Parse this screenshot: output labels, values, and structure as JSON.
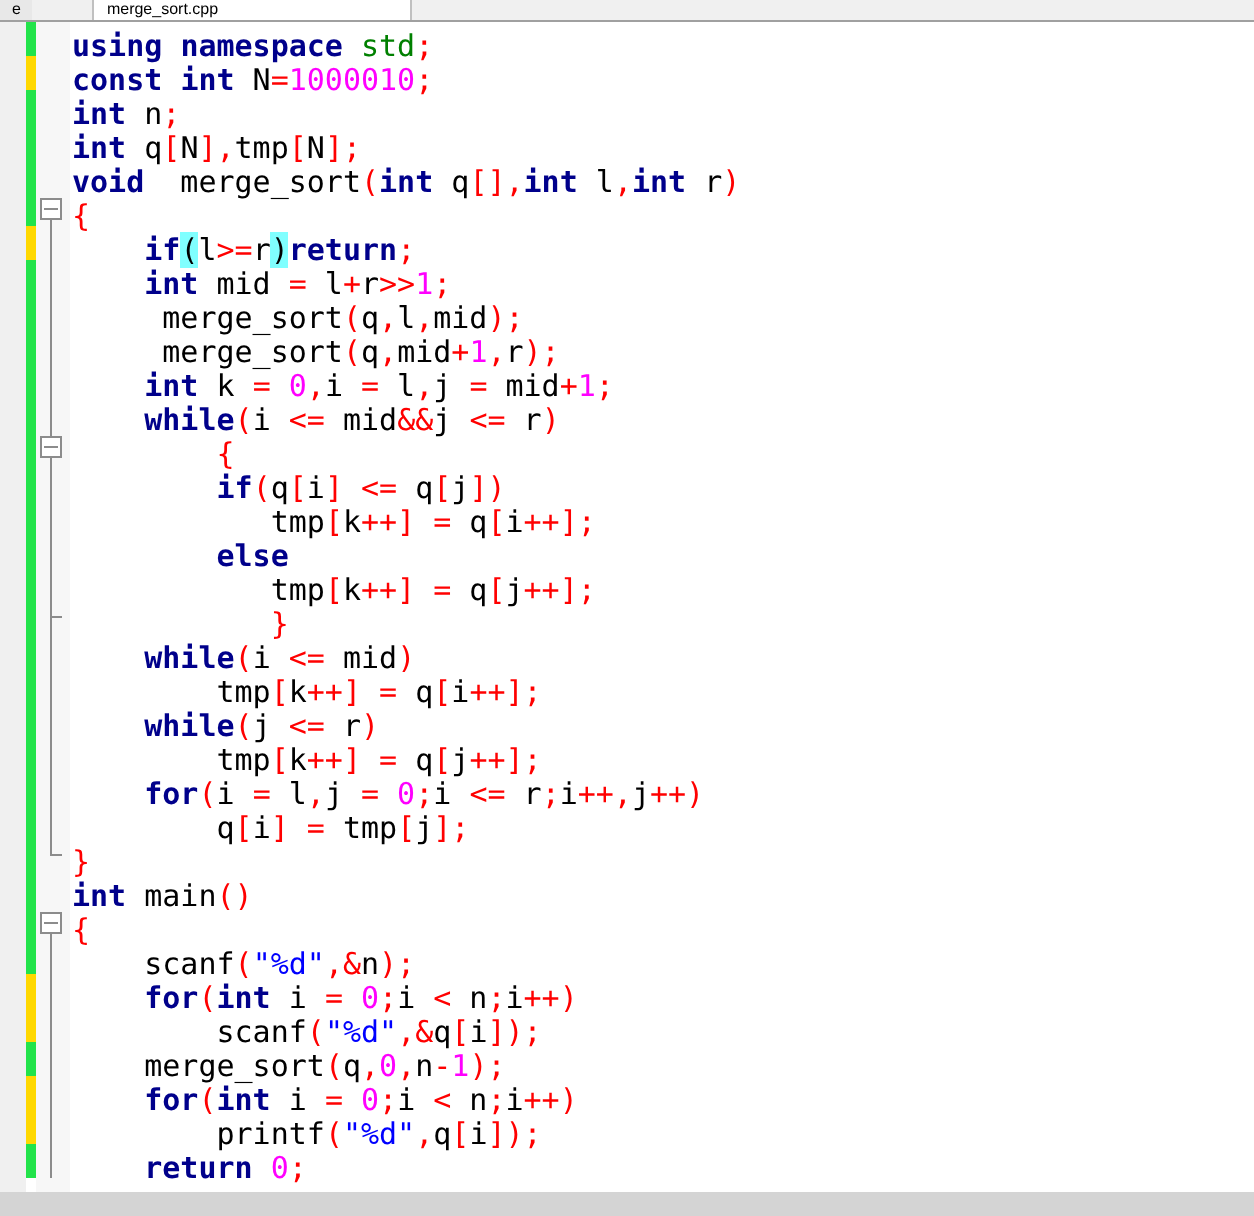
{
  "tabs": [
    {
      "label": "e",
      "selected": false
    },
    {
      "label": "merge_sort.cpp",
      "selected": true
    }
  ],
  "lines": [
    {
      "modified": false,
      "kind": "plain",
      "tokens": [
        {
          "kind": "kw",
          "text": "using "
        },
        {
          "kind": "kw",
          "text": "namespace "
        },
        {
          "kind": "ns",
          "text": "std"
        },
        {
          "kind": "op",
          "text": ";"
        }
      ]
    },
    {
      "modified": true,
      "kind": "plain",
      "tokens": [
        {
          "kind": "kw",
          "text": "const "
        },
        {
          "kind": "kw",
          "text": "int"
        },
        {
          "kind": "id",
          "text": " N"
        },
        {
          "kind": "op",
          "text": "="
        },
        {
          "kind": "num",
          "text": "1000010"
        },
        {
          "kind": "op",
          "text": ";"
        }
      ]
    },
    {
      "modified": false,
      "kind": "plain",
      "tokens": [
        {
          "kind": "kw",
          "text": "int"
        },
        {
          "kind": "id",
          "text": " n"
        },
        {
          "kind": "op",
          "text": ";"
        }
      ]
    },
    {
      "modified": false,
      "kind": "plain",
      "tokens": [
        {
          "kind": "kw",
          "text": "int"
        },
        {
          "kind": "id",
          "text": " q"
        },
        {
          "kind": "op",
          "text": "["
        },
        {
          "kind": "id",
          "text": "N"
        },
        {
          "kind": "op",
          "text": "],"
        },
        {
          "kind": "id",
          "text": "tmp"
        },
        {
          "kind": "op",
          "text": "["
        },
        {
          "kind": "id",
          "text": "N"
        },
        {
          "kind": "op",
          "text": "];"
        }
      ]
    },
    {
      "modified": false,
      "kind": "plain",
      "tokens": [
        {
          "kind": "kw",
          "text": "void"
        },
        {
          "kind": "id",
          "text": "  merge_sort"
        },
        {
          "kind": "op",
          "text": "("
        },
        {
          "kind": "kw",
          "text": "int"
        },
        {
          "kind": "id",
          "text": " q"
        },
        {
          "kind": "op",
          "text": "[],"
        },
        {
          "kind": "kw",
          "text": "int"
        },
        {
          "kind": "id",
          "text": " l"
        },
        {
          "kind": "op",
          "text": ","
        },
        {
          "kind": "kw",
          "text": "int"
        },
        {
          "kind": "id",
          "text": " r"
        },
        {
          "kind": "op",
          "text": ")"
        }
      ]
    },
    {
      "modified": false,
      "kind": "fold_start",
      "tokens": [
        {
          "kind": "op",
          "text": "{"
        }
      ]
    },
    {
      "modified": true,
      "kind": "plain",
      "tokens": [
        {
          "kind": "kw",
          "text": "    if"
        },
        {
          "kind": "match",
          "text": "("
        },
        {
          "kind": "id",
          "text": "l"
        },
        {
          "kind": "op",
          "text": ">="
        },
        {
          "kind": "id",
          "text": "r"
        },
        {
          "kind": "match",
          "text": ")"
        },
        {
          "kind": "kw",
          "text": "return"
        },
        {
          "kind": "op",
          "text": ";"
        }
      ]
    },
    {
      "modified": false,
      "kind": "plain",
      "tokens": [
        {
          "kind": "kw",
          "text": "    int"
        },
        {
          "kind": "id",
          "text": " mid "
        },
        {
          "kind": "op",
          "text": "="
        },
        {
          "kind": "id",
          "text": " l"
        },
        {
          "kind": "op",
          "text": "+"
        },
        {
          "kind": "id",
          "text": "r"
        },
        {
          "kind": "op",
          "text": ">>"
        },
        {
          "kind": "num",
          "text": "1"
        },
        {
          "kind": "op",
          "text": ";"
        }
      ]
    },
    {
      "modified": false,
      "kind": "plain",
      "tokens": [
        {
          "kind": "id",
          "text": "     merge_sort"
        },
        {
          "kind": "op",
          "text": "("
        },
        {
          "kind": "id",
          "text": "q"
        },
        {
          "kind": "op",
          "text": ","
        },
        {
          "kind": "id",
          "text": "l"
        },
        {
          "kind": "op",
          "text": ","
        },
        {
          "kind": "id",
          "text": "mid"
        },
        {
          "kind": "op",
          "text": ");"
        }
      ]
    },
    {
      "modified": false,
      "kind": "plain",
      "tokens": [
        {
          "kind": "id",
          "text": "     merge_sort"
        },
        {
          "kind": "op",
          "text": "("
        },
        {
          "kind": "id",
          "text": "q"
        },
        {
          "kind": "op",
          "text": ","
        },
        {
          "kind": "id",
          "text": "mid"
        },
        {
          "kind": "op",
          "text": "+"
        },
        {
          "kind": "num",
          "text": "1"
        },
        {
          "kind": "op",
          "text": ","
        },
        {
          "kind": "id",
          "text": "r"
        },
        {
          "kind": "op",
          "text": ");"
        }
      ]
    },
    {
      "modified": false,
      "kind": "plain",
      "tokens": [
        {
          "kind": "kw",
          "text": "    int"
        },
        {
          "kind": "id",
          "text": " k "
        },
        {
          "kind": "op",
          "text": "="
        },
        {
          "kind": "num",
          "text": " 0"
        },
        {
          "kind": "op",
          "text": ","
        },
        {
          "kind": "id",
          "text": "i "
        },
        {
          "kind": "op",
          "text": "="
        },
        {
          "kind": "id",
          "text": " l"
        },
        {
          "kind": "op",
          "text": ","
        },
        {
          "kind": "id",
          "text": "j "
        },
        {
          "kind": "op",
          "text": "="
        },
        {
          "kind": "id",
          "text": " mid"
        },
        {
          "kind": "op",
          "text": "+"
        },
        {
          "kind": "num",
          "text": "1"
        },
        {
          "kind": "op",
          "text": ";"
        }
      ]
    },
    {
      "modified": false,
      "kind": "plain",
      "tokens": [
        {
          "kind": "kw",
          "text": "    while"
        },
        {
          "kind": "op",
          "text": "("
        },
        {
          "kind": "id",
          "text": "i "
        },
        {
          "kind": "op",
          "text": "<="
        },
        {
          "kind": "id",
          "text": " mid"
        },
        {
          "kind": "op",
          "text": "&&"
        },
        {
          "kind": "id",
          "text": "j "
        },
        {
          "kind": "op",
          "text": "<="
        },
        {
          "kind": "id",
          "text": " r"
        },
        {
          "kind": "op",
          "text": ")"
        }
      ]
    },
    {
      "modified": false,
      "kind": "fold_start",
      "tokens": [
        {
          "kind": "op",
          "text": "        {"
        }
      ]
    },
    {
      "modified": false,
      "kind": "plain",
      "tokens": [
        {
          "kind": "kw",
          "text": "        if"
        },
        {
          "kind": "op",
          "text": "("
        },
        {
          "kind": "id",
          "text": "q"
        },
        {
          "kind": "op",
          "text": "["
        },
        {
          "kind": "id",
          "text": "i"
        },
        {
          "kind": "op",
          "text": "] <="
        },
        {
          "kind": "id",
          "text": " q"
        },
        {
          "kind": "op",
          "text": "["
        },
        {
          "kind": "id",
          "text": "j"
        },
        {
          "kind": "op",
          "text": "])"
        }
      ]
    },
    {
      "modified": false,
      "kind": "plain",
      "tokens": [
        {
          "kind": "id",
          "text": "           tmp"
        },
        {
          "kind": "op",
          "text": "["
        },
        {
          "kind": "id",
          "text": "k"
        },
        {
          "kind": "op",
          "text": "++] ="
        },
        {
          "kind": "id",
          "text": " q"
        },
        {
          "kind": "op",
          "text": "["
        },
        {
          "kind": "id",
          "text": "i"
        },
        {
          "kind": "op",
          "text": "++];"
        }
      ]
    },
    {
      "modified": false,
      "kind": "plain",
      "tokens": [
        {
          "kind": "kw",
          "text": "        else"
        }
      ]
    },
    {
      "modified": false,
      "kind": "plain",
      "tokens": [
        {
          "kind": "id",
          "text": "           tmp"
        },
        {
          "kind": "op",
          "text": "["
        },
        {
          "kind": "id",
          "text": "k"
        },
        {
          "kind": "op",
          "text": "++] ="
        },
        {
          "kind": "id",
          "text": " q"
        },
        {
          "kind": "op",
          "text": "["
        },
        {
          "kind": "id",
          "text": "j"
        },
        {
          "kind": "op",
          "text": "++];"
        }
      ]
    },
    {
      "modified": false,
      "kind": "fold_end",
      "tokens": [
        {
          "kind": "op",
          "text": "           }"
        }
      ]
    },
    {
      "modified": false,
      "kind": "plain",
      "tokens": [
        {
          "kind": "kw",
          "text": "    while"
        },
        {
          "kind": "op",
          "text": "("
        },
        {
          "kind": "id",
          "text": "i "
        },
        {
          "kind": "op",
          "text": "<="
        },
        {
          "kind": "id",
          "text": " mid"
        },
        {
          "kind": "op",
          "text": ")"
        }
      ]
    },
    {
      "modified": false,
      "kind": "plain",
      "tokens": [
        {
          "kind": "id",
          "text": "        tmp"
        },
        {
          "kind": "op",
          "text": "["
        },
        {
          "kind": "id",
          "text": "k"
        },
        {
          "kind": "op",
          "text": "++] ="
        },
        {
          "kind": "id",
          "text": " q"
        },
        {
          "kind": "op",
          "text": "["
        },
        {
          "kind": "id",
          "text": "i"
        },
        {
          "kind": "op",
          "text": "++];"
        }
      ]
    },
    {
      "modified": false,
      "kind": "plain",
      "tokens": [
        {
          "kind": "kw",
          "text": "    while"
        },
        {
          "kind": "op",
          "text": "("
        },
        {
          "kind": "id",
          "text": "j "
        },
        {
          "kind": "op",
          "text": "<="
        },
        {
          "kind": "id",
          "text": " r"
        },
        {
          "kind": "op",
          "text": ")"
        }
      ]
    },
    {
      "modified": false,
      "kind": "plain",
      "tokens": [
        {
          "kind": "id",
          "text": "        tmp"
        },
        {
          "kind": "op",
          "text": "["
        },
        {
          "kind": "id",
          "text": "k"
        },
        {
          "kind": "op",
          "text": "++] ="
        },
        {
          "kind": "id",
          "text": " q"
        },
        {
          "kind": "op",
          "text": "["
        },
        {
          "kind": "id",
          "text": "j"
        },
        {
          "kind": "op",
          "text": "++];"
        }
      ]
    },
    {
      "modified": false,
      "kind": "plain",
      "tokens": [
        {
          "kind": "kw",
          "text": "    for"
        },
        {
          "kind": "op",
          "text": "("
        },
        {
          "kind": "id",
          "text": "i "
        },
        {
          "kind": "op",
          "text": "="
        },
        {
          "kind": "id",
          "text": " l"
        },
        {
          "kind": "op",
          "text": ","
        },
        {
          "kind": "id",
          "text": "j "
        },
        {
          "kind": "op",
          "text": "="
        },
        {
          "kind": "num",
          "text": " 0"
        },
        {
          "kind": "op",
          "text": ";"
        },
        {
          "kind": "id",
          "text": "i "
        },
        {
          "kind": "op",
          "text": "<="
        },
        {
          "kind": "id",
          "text": " r"
        },
        {
          "kind": "op",
          "text": ";"
        },
        {
          "kind": "id",
          "text": "i"
        },
        {
          "kind": "op",
          "text": "++,"
        },
        {
          "kind": "id",
          "text": "j"
        },
        {
          "kind": "op",
          "text": "++)"
        }
      ]
    },
    {
      "modified": false,
      "kind": "plain",
      "tokens": [
        {
          "kind": "id",
          "text": "        q"
        },
        {
          "kind": "op",
          "text": "["
        },
        {
          "kind": "id",
          "text": "i"
        },
        {
          "kind": "op",
          "text": "] ="
        },
        {
          "kind": "id",
          "text": " tmp"
        },
        {
          "kind": "op",
          "text": "["
        },
        {
          "kind": "id",
          "text": "j"
        },
        {
          "kind": "op",
          "text": "];"
        }
      ]
    },
    {
      "modified": false,
      "kind": "fold_end",
      "tokens": [
        {
          "kind": "op",
          "text": "}"
        }
      ]
    },
    {
      "modified": false,
      "kind": "plain",
      "tokens": [
        {
          "kind": "kw",
          "text": "int"
        },
        {
          "kind": "id",
          "text": " main"
        },
        {
          "kind": "op",
          "text": "()"
        }
      ]
    },
    {
      "modified": false,
      "kind": "fold_start",
      "tokens": [
        {
          "kind": "op",
          "text": "{"
        }
      ]
    },
    {
      "modified": false,
      "kind": "plain",
      "tokens": [
        {
          "kind": "id",
          "text": "    scanf"
        },
        {
          "kind": "op",
          "text": "("
        },
        {
          "kind": "str",
          "text": "\"%d\""
        },
        {
          "kind": "op",
          "text": ",&"
        },
        {
          "kind": "id",
          "text": "n"
        },
        {
          "kind": "op",
          "text": ");"
        }
      ]
    },
    {
      "modified": true,
      "kind": "plain",
      "tokens": [
        {
          "kind": "kw",
          "text": "    for"
        },
        {
          "kind": "op",
          "text": "("
        },
        {
          "kind": "kw",
          "text": "int"
        },
        {
          "kind": "id",
          "text": " i "
        },
        {
          "kind": "op",
          "text": "="
        },
        {
          "kind": "num",
          "text": " 0"
        },
        {
          "kind": "op",
          "text": ";"
        },
        {
          "kind": "id",
          "text": "i "
        },
        {
          "kind": "op",
          "text": "<"
        },
        {
          "kind": "id",
          "text": " n"
        },
        {
          "kind": "op",
          "text": ";"
        },
        {
          "kind": "id",
          "text": "i"
        },
        {
          "kind": "op",
          "text": "++)"
        }
      ]
    },
    {
      "modified": true,
      "kind": "plain",
      "tokens": [
        {
          "kind": "id",
          "text": "        scanf"
        },
        {
          "kind": "op",
          "text": "("
        },
        {
          "kind": "str",
          "text": "\"%d\""
        },
        {
          "kind": "op",
          "text": ",&"
        },
        {
          "kind": "id",
          "text": "q"
        },
        {
          "kind": "op",
          "text": "["
        },
        {
          "kind": "id",
          "text": "i"
        },
        {
          "kind": "op",
          "text": "]);"
        }
      ]
    },
    {
      "modified": false,
      "kind": "plain",
      "tokens": [
        {
          "kind": "id",
          "text": "    merge_sort"
        },
        {
          "kind": "op",
          "text": "("
        },
        {
          "kind": "id",
          "text": "q"
        },
        {
          "kind": "op",
          "text": ","
        },
        {
          "kind": "num",
          "text": "0"
        },
        {
          "kind": "op",
          "text": ","
        },
        {
          "kind": "id",
          "text": "n"
        },
        {
          "kind": "op",
          "text": "-"
        },
        {
          "kind": "num",
          "text": "1"
        },
        {
          "kind": "op",
          "text": ");"
        }
      ]
    },
    {
      "modified": true,
      "kind": "plain",
      "tokens": [
        {
          "kind": "kw",
          "text": "    for"
        },
        {
          "kind": "op",
          "text": "("
        },
        {
          "kind": "kw",
          "text": "int"
        },
        {
          "kind": "id",
          "text": " i "
        },
        {
          "kind": "op",
          "text": "="
        },
        {
          "kind": "num",
          "text": " 0"
        },
        {
          "kind": "op",
          "text": ";"
        },
        {
          "kind": "id",
          "text": "i "
        },
        {
          "kind": "op",
          "text": "<"
        },
        {
          "kind": "id",
          "text": " n"
        },
        {
          "kind": "op",
          "text": ";"
        },
        {
          "kind": "id",
          "text": "i"
        },
        {
          "kind": "op",
          "text": "++)"
        }
      ]
    },
    {
      "modified": true,
      "kind": "plain",
      "tokens": [
        {
          "kind": "id",
          "text": "        printf"
        },
        {
          "kind": "op",
          "text": "("
        },
        {
          "kind": "str",
          "text": "\"%d\""
        },
        {
          "kind": "op",
          "text": ","
        },
        {
          "kind": "id",
          "text": "q"
        },
        {
          "kind": "op",
          "text": "["
        },
        {
          "kind": "id",
          "text": "i"
        },
        {
          "kind": "op",
          "text": "]);"
        }
      ]
    },
    {
      "modified": false,
      "kind": "plain",
      "tokens": [
        {
          "kind": "kw",
          "text": "    return"
        },
        {
          "kind": "num",
          "text": " 0"
        },
        {
          "kind": "op",
          "text": ";"
        }
      ]
    }
  ]
}
